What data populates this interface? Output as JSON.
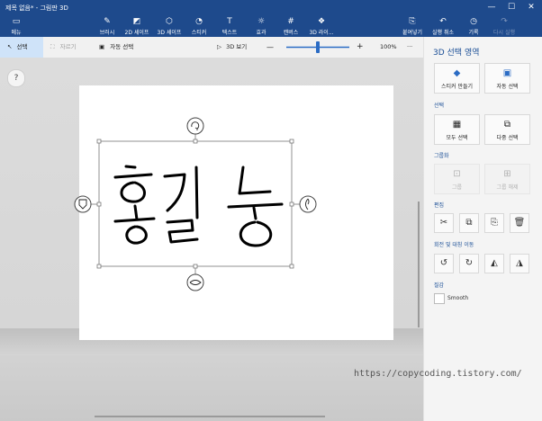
{
  "window": {
    "title": "제목 없음* - 그림판 3D",
    "minimize_glyph": "—",
    "restore_glyph": "☐",
    "close_glyph": "✕"
  },
  "ribbon": {
    "menu_label": "메뉴",
    "tools": [
      {
        "label": "브러시",
        "icon": "brush-icon",
        "glyph": "✎"
      },
      {
        "label": "2D 셰이프",
        "icon": "2d-shapes-icon",
        "glyph": "◩"
      },
      {
        "label": "3D 셰이프",
        "icon": "3d-shapes-icon",
        "glyph": "⬡"
      },
      {
        "label": "스티커",
        "icon": "sticker-icon",
        "glyph": "◔"
      },
      {
        "label": "텍스트",
        "icon": "text-icon",
        "glyph": "T"
      },
      {
        "label": "효과",
        "icon": "effects-icon",
        "glyph": "☼"
      },
      {
        "label": "캔버스",
        "icon": "canvas-icon",
        "glyph": "#"
      },
      {
        "label": "3D 라이...",
        "icon": "3d-library-icon",
        "glyph": "❖"
      }
    ],
    "actions": [
      {
        "label": "붙여넣기",
        "icon": "paste-icon",
        "glyph": "⎘"
      },
      {
        "label": "실행 취소",
        "icon": "undo-icon",
        "glyph": "↶"
      },
      {
        "label": "기록",
        "icon": "history-icon",
        "glyph": "◷"
      },
      {
        "label": "다시 실행",
        "icon": "redo-icon",
        "glyph": "↷"
      }
    ]
  },
  "toolbar": {
    "select_label": "선택",
    "crop_label": "자르기",
    "magic_select_label": "자동 선택",
    "view_3d_label": "3D 보기",
    "zoom_out": "—",
    "zoom_in": "+",
    "zoom_value": "100%",
    "more": "···",
    "zoom_level": 0.5
  },
  "help_label": "?",
  "canvas": {
    "handwriting": "홍길동",
    "stroke_color": "#000000"
  },
  "panel": {
    "title": "3D 선택 영역",
    "make_sticker": "스티커 만들기",
    "magic_select": "자동 선택",
    "section_select": "선택",
    "select_all": "모두 선택",
    "multi_select": "다중 선택",
    "section_group": "그룹화",
    "group": "그룹",
    "ungroup": "그룹 해제",
    "section_edit": "편집",
    "edit_glyphs": [
      "✂",
      "⧉",
      "⎘",
      "🗑"
    ],
    "section_rotate": "회전 및 대칭 이동",
    "rotate_glyphs": [
      "↺",
      "↻",
      "◭",
      "◮"
    ],
    "section_texture": "질감",
    "smooth_label": "Smooth"
  },
  "watermark": "https://copycoding.tistory.com/",
  "colors": {
    "accent": "#1e4a8c",
    "panel_text": "#1a4e96",
    "slider": "#2b6cc4"
  }
}
